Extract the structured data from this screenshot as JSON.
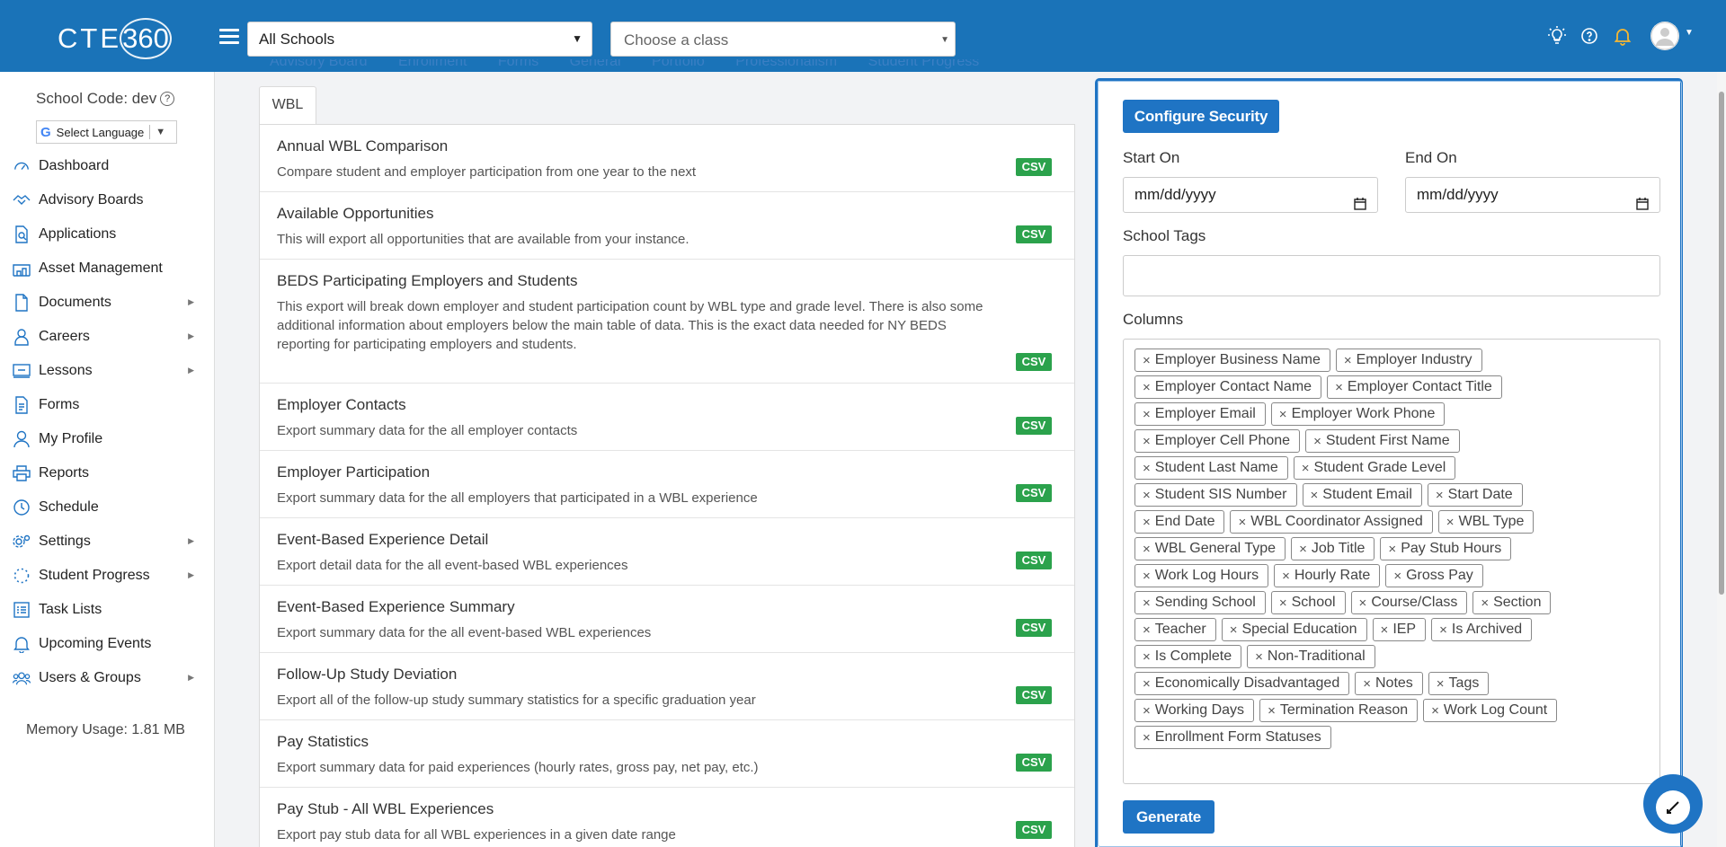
{
  "header": {
    "logo_text": "CTE",
    "logo_number": "360",
    "school_select": "All Schools",
    "class_select_placeholder": "Choose a class"
  },
  "sidebar": {
    "school_code": "School Code: dev",
    "language": "Select Language",
    "language_g": "G",
    "items": [
      {
        "label": "Dashboard",
        "icon": "dashboard-icon"
      },
      {
        "label": "Advisory Boards",
        "icon": "handshake-icon"
      },
      {
        "label": "Applications",
        "icon": "file-search-icon"
      },
      {
        "label": "Asset Management",
        "icon": "warehouse-icon",
        "submenu": false
      },
      {
        "label": "Documents",
        "icon": "document-icon",
        "submenu": true
      },
      {
        "label": "Careers",
        "icon": "careers-icon",
        "submenu": true
      },
      {
        "label": "Lessons",
        "icon": "lessons-icon",
        "submenu": true
      },
      {
        "label": "Forms",
        "icon": "form-icon"
      },
      {
        "label": "My Profile",
        "icon": "user-icon"
      },
      {
        "label": "Reports",
        "icon": "print-icon"
      },
      {
        "label": "Schedule",
        "icon": "clock-icon"
      },
      {
        "label": "Settings",
        "icon": "gear-icon",
        "submenu": true
      },
      {
        "label": "Student Progress",
        "icon": "progress-icon",
        "submenu": true
      },
      {
        "label": "Task Lists",
        "icon": "list-icon"
      },
      {
        "label": "Upcoming Events",
        "icon": "bell-icon"
      },
      {
        "label": "Users & Groups",
        "icon": "users-icon",
        "submenu": true
      }
    ],
    "memory": "Memory Usage: 1.81 MB"
  },
  "hidden_tabs": [
    "Advisory Board",
    "Enrollment",
    "Forms",
    "General",
    "Portfolio",
    "Professionalism",
    "Student Progress"
  ],
  "active_tab": "WBL",
  "reports": [
    {
      "title": "Annual WBL Comparison",
      "desc": "Compare student and employer participation from one year to the next",
      "badge": "CSV"
    },
    {
      "title": "Available Opportunities",
      "desc": "This will export all opportunities that are available from your instance.",
      "badge": "CSV"
    },
    {
      "title": "BEDS Participating Employers and Students",
      "desc": "This export will break down employer and student participation count by WBL type and grade level. There is also some additional information about employers below the main table of data. This is the exact data needed for NY BEDS reporting for participating employers and students.",
      "badge": "CSV"
    },
    {
      "title": "Employer Contacts",
      "desc": "Export summary data for the all employer contacts",
      "badge": "CSV"
    },
    {
      "title": "Employer Participation",
      "desc": "Export summary data for the all employers that participated in a WBL experience",
      "badge": "CSV"
    },
    {
      "title": "Event-Based Experience Detail",
      "desc": "Export detail data for the all event-based WBL experiences",
      "badge": "CSV"
    },
    {
      "title": "Event-Based Experience Summary",
      "desc": "Export summary data for the all event-based WBL experiences",
      "badge": "CSV"
    },
    {
      "title": "Follow-Up Study Deviation",
      "desc": "Export all of the follow-up study summary statistics for a specific graduation year",
      "badge": "CSV"
    },
    {
      "title": "Pay Statistics",
      "desc": "Export summary data for paid experiences (hourly rates, gross pay, net pay, etc.)",
      "badge": "CSV"
    },
    {
      "title": "Pay Stub - All WBL Experiences",
      "desc": "Export pay stub data for all WBL experiences in a given date range",
      "badge": "CSV"
    }
  ],
  "panel": {
    "configure_button": "Configure Security",
    "start_label": "Start On",
    "end_label": "End On",
    "start_value": "mm/dd/yyyy",
    "end_value": "mm/dd/yyyy",
    "tags_label": "School Tags",
    "columns_label": "Columns",
    "generate_button": "Generate",
    "column_rows": [
      [
        "Employer Business Name",
        "Employer Industry"
      ],
      [
        "Employer Contact Name",
        "Employer Contact Title"
      ],
      [
        "Employer Email",
        "Employer Work Phone"
      ],
      [
        "Employer Cell Phone",
        "Student First Name"
      ],
      [
        "Student Last Name",
        "Student Grade Level"
      ],
      [
        "Student SIS Number",
        "Student Email",
        "Start Date"
      ],
      [
        "End Date",
        "WBL Coordinator Assigned",
        "WBL Type"
      ],
      [
        "WBL General Type",
        "Job Title",
        "Pay Stub Hours"
      ],
      [
        "Work Log Hours",
        "Hourly Rate",
        "Gross Pay"
      ],
      [
        "Sending School",
        "School",
        "Course/Class",
        "Section"
      ],
      [
        "Teacher",
        "Special Education",
        "IEP",
        "Is Archived"
      ],
      [
        "Is Complete",
        "Non-Traditional"
      ],
      [
        "Economically Disadvantaged",
        "Notes",
        "Tags"
      ],
      [
        "Working Days",
        "Termination Reason",
        "Work Log Count"
      ],
      [
        "Enrollment Form Statuses"
      ]
    ]
  },
  "colors": {
    "brand": "#1a73b8",
    "csv_badge": "#2ba24c",
    "primary_button": "#1f74c4"
  }
}
